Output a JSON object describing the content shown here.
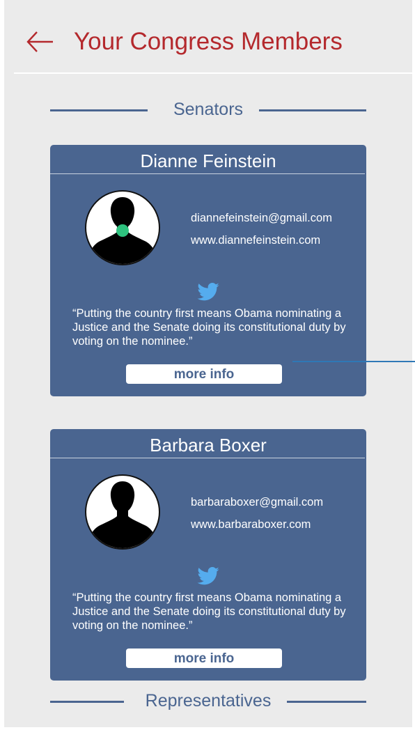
{
  "header": {
    "title": "Your Congress Members",
    "back_icon": "arrow-left-icon"
  },
  "sections": {
    "senators": "Senators",
    "representatives": "Representatives"
  },
  "members": [
    {
      "name": "Dianne Feinstein",
      "email": "diannefeinstein@gmail.com",
      "website": "www.diannefeinstein.com",
      "quote": "“Putting the country first means Obama nominating a Justice and the Senate doing its constitutional duty by voting on the nominee.”",
      "more_label": "more info",
      "status_dot_color": "#2ec27e"
    },
    {
      "name": "Barbara Boxer",
      "email": "barbaraboxer@gmail.com",
      "website": "www.barbaraboxer.com",
      "quote": "“Putting the country first means Obama nominating a Justice and the Senate doing its constitutional duty by voting on the nominee.”",
      "more_label": "more info"
    }
  ],
  "colors": {
    "title_red": "#b4292d",
    "card_blue": "#4a6590",
    "background": "#ebebeb",
    "twitter_blue": "#55acee",
    "connector_blue": "#2f78b6"
  }
}
